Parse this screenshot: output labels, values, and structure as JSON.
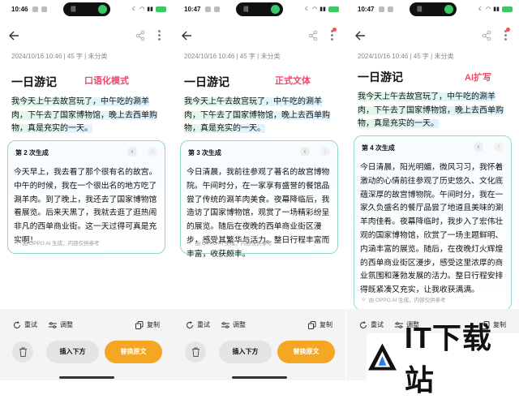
{
  "panels": [
    {
      "time": "10:46",
      "meta": "2024/10/16 10:46 | 45 字 | 未分类",
      "title": "一日游记",
      "mode": "口语化模式",
      "original": "我今天上午去故宫玩了，中午吃的涮羊肉，下午去了国家博物馆，晚上去西单购物，真是充实的一天。",
      "gen_label": "第 2 次生成",
      "generated": "今天早上，我去看了那个很有名的故宫。中午的时候，我在一个很出名的地方吃了涮羊肉。到了晚上，我还去了国家博物馆看展览。后来天黑了，我就去逛了逛热闹非凡的西单商业街。这一天过得可真是充实啊！",
      "footer": "由 OPPO AI 生成，内容仅供参考",
      "retry": "重试",
      "adjust": "调整",
      "copy": "复制",
      "insert": "插入下方",
      "replace": "替换原文"
    },
    {
      "time": "10:47",
      "meta": "2024/10/16 10:46 | 45 字 | 未分类",
      "title": "一日游记",
      "mode": "正式文体",
      "original": "我今天上午去故宫玩了，中午吃的涮羊肉，下午去了国家博物馆，晚上去西单购物，真是充实的一天。",
      "gen_label": "第 3 次生成",
      "generated": "今日清晨，我前往参观了著名的故宫博物院。午间时分，在一家享有盛誉的餐馆品尝了传统的涮羊肉美食。夜幕降临后，我造访了国家博物馆，观赏了一场精彩纷呈的展览。随后在夜晚的西单商业街区漫步，感受其繁华与活力。整日行程丰富而丰富，收获颇丰。",
      "footer": "由 OPPO AI 生成，内容仅供参考",
      "retry": "重试",
      "adjust": "调整",
      "copy": "复制",
      "insert": "插入下方",
      "replace": "替换原文"
    },
    {
      "time": "10:47",
      "meta": "2024/10/16 10:46 | 45 字 | 未分类",
      "title": "一日游记",
      "mode": "AI扩写",
      "original": "我今天上午去故宫玩了，中午吃的涮羊肉，下午去了国家博物馆，晚上去西单购物，真是充实的一天。",
      "gen_label": "第 4 次生成",
      "generated": "今日清晨，阳光明媚，微风习习，我怀着激动的心情前往参观了历史悠久、文化底蕴深厚的故宫博物院。午间时分，我在一家久负盛名的餐厅品尝了地道且美味的涮羊肉佳肴。夜幕降临时，我步入了宏伟壮观的国家博物馆，欣赏了一场主题鲜明、内涵丰富的展览。随后，在夜晚灯火辉煌的西单商业街区漫步，感受这里浓厚的商业氛围和蓬勃发展的活力。整日行程安排得既紧凑又充实，让我收获满满。",
      "footer": "由 OPPO AI 生成，内容仅供参考",
      "retry": "重试",
      "adjust": "调整",
      "copy": "复制",
      "insert": "",
      "replace": ""
    }
  ],
  "watermark": "IT下载站",
  "colors": {
    "accent_orange": "#f5a623",
    "mode_pink": "#ea4b6a",
    "card_border": "#8fd8c4"
  }
}
